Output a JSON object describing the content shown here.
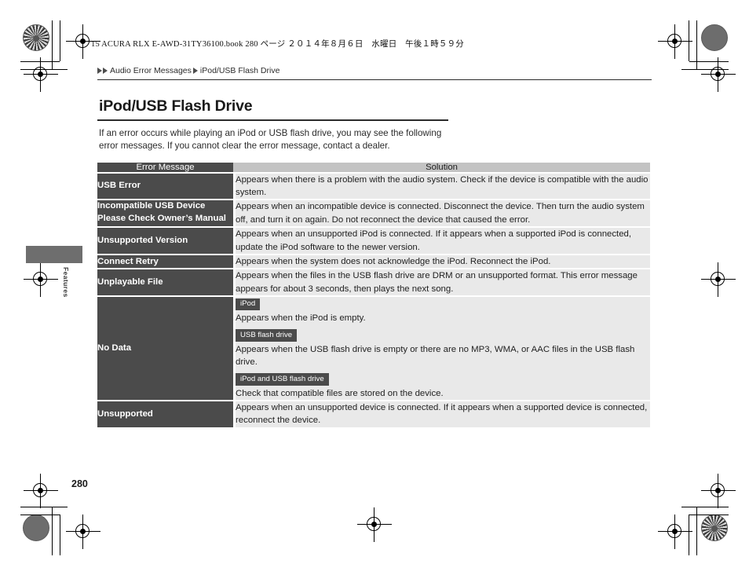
{
  "running_head": "15 ACURA RLX E-AWD-31TY36100.book   280 ページ   ２０１４年８月６日　水曜日　午後１時５９分",
  "side_tab": {
    "label": "Features"
  },
  "breadcrumb": {
    "level1": "Audio Error Messages",
    "level2": "iPod/USB Flash Drive"
  },
  "page": {
    "title": "iPod/USB Flash Drive",
    "intro": "If an error occurs while playing an iPod or USB flash drive, you may see the following error messages. If you cannot clear the error message, contact a dealer.",
    "folio": "280"
  },
  "table": {
    "headers": {
      "col1": "Error Message",
      "col2": "Solution"
    },
    "rows": [
      {
        "message": "USB Error",
        "solution": "Appears when there is a problem with the audio system. Check if the device is compatible with the audio system."
      },
      {
        "message": "Incompatible USB Device Please Check Owner’s Manual",
        "solution": "Appears when an incompatible device is connected. Disconnect the device. Then turn the audio system off, and turn it on again. Do not reconnect the device that caused the error."
      },
      {
        "message": "Unsupported Version",
        "solution": "Appears when an unsupported iPod is connected. If it appears when a supported iPod is connected, update the iPod software to the newer version."
      },
      {
        "message": "Connect Retry",
        "solution": "Appears when the system does not acknowledge the iPod. Reconnect the iPod."
      },
      {
        "message": "Unplayable File",
        "solution": "Appears when the files in the USB flash drive are DRM or an unsupported format. This error message appears for about 3 seconds, then plays the next song."
      },
      {
        "message": "Unsupported",
        "solution": "Appears when an unsupported device is connected. If it appears when a supported device is connected, reconnect the device."
      }
    ],
    "no_data_row": {
      "message": "No Data",
      "blocks": [
        {
          "badge": "iPod",
          "text": "Appears when the iPod is empty."
        },
        {
          "badge": "USB flash drive",
          "text": "Appears when the USB flash drive is empty or there are no MP3, WMA, or AAC files in the USB flash drive."
        },
        {
          "badge": "iPod and USB flash drive",
          "text": "Check that compatible files are stored on the device."
        }
      ]
    }
  },
  "colors": {
    "header_dark": "#4b4b4b",
    "header_light": "#c3c3c3",
    "label_cell": "#4b4b4b",
    "solution_cell": "#e9e9e9",
    "side_tab": "#6e6e6e"
  }
}
